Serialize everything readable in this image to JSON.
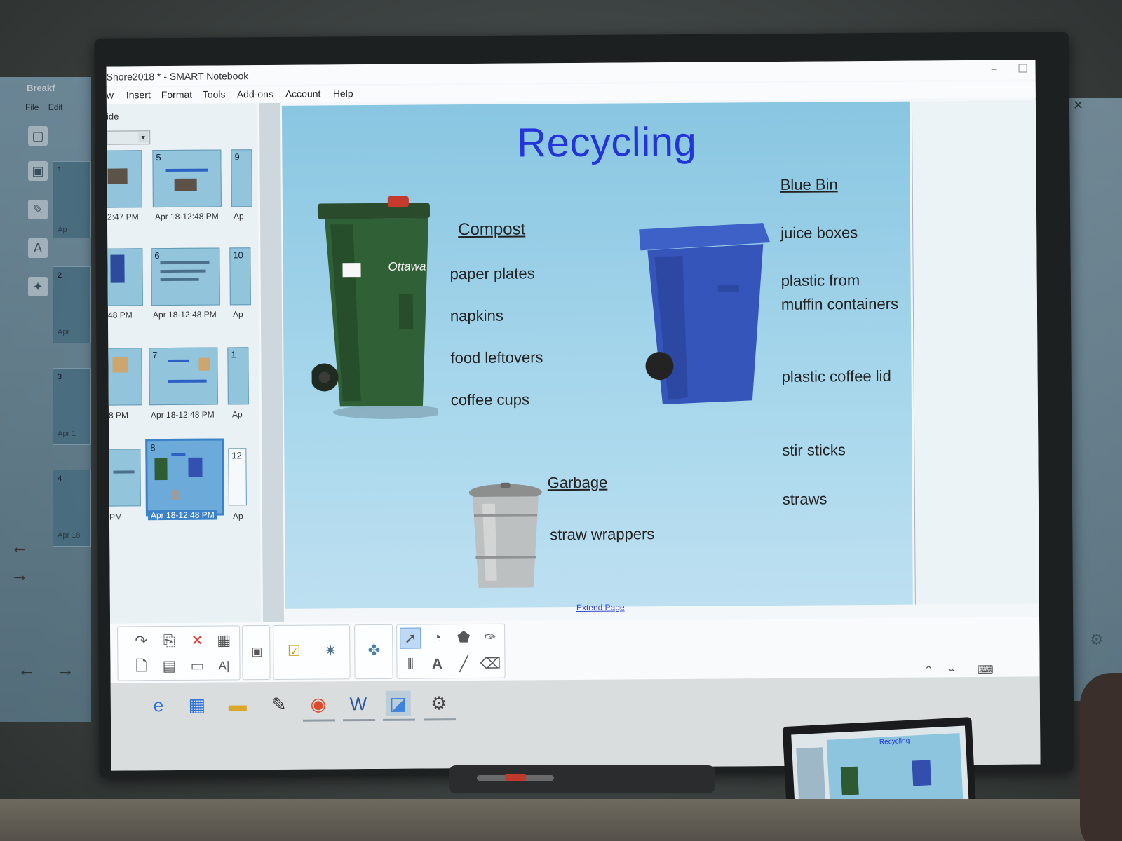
{
  "window": {
    "title": "Shore2018 * - SMART Notebook",
    "minimize": "–"
  },
  "menu": {
    "items": [
      "w",
      "Insert",
      "Format",
      "Tools",
      "Add-ons",
      "Account",
      "Help"
    ]
  },
  "ghost_window": {
    "title": "Breakf",
    "menu": [
      "File",
      "Edit"
    ],
    "thumb_numbers": [
      "1",
      "2",
      "3",
      "4"
    ],
    "dates": [
      "Ap",
      "Apr",
      "Apr 1",
      "Apr 18"
    ]
  },
  "sorter": {
    "hide_label": "ide",
    "scroll_arrow": "›",
    "columns": [
      {
        "numbers": [
          "",
          "",
          "",
          ""
        ],
        "labels": [
          "2:47 PM",
          "48 PM",
          "8 PM",
          "PM"
        ]
      },
      {
        "numbers": [
          "5",
          "6",
          "7",
          "8"
        ],
        "labels": [
          "Apr 18-12:48 PM",
          "Apr 18-12:48 PM",
          "Apr 18-12:48 PM",
          "Apr 18-12:48 PM"
        ]
      },
      {
        "numbers": [
          "9",
          "10",
          "1",
          "12"
        ],
        "labels": [
          "Ap",
          "Ap",
          "Ap",
          "Ap"
        ]
      }
    ]
  },
  "slide": {
    "title": "Recycling",
    "compost": {
      "heading": "Compost",
      "items": [
        "paper plates",
        "napkins",
        "food leftovers",
        "coffee cups"
      ]
    },
    "blue_bin": {
      "heading": "Blue Bin",
      "items": [
        "juice boxes",
        "plastic from muffin containers",
        "plastic coffee lid",
        "stir sticks",
        "straws"
      ]
    },
    "garbage": {
      "heading": "Garbage",
      "items": [
        "straw wrappers"
      ]
    },
    "bin_logo": "Ottawa",
    "extend_link": "Extend Page"
  },
  "toolbar": {
    "icons": [
      "redo-icon",
      "paste-icon",
      "delete-icon",
      "table-icon",
      "open-icon",
      "save-icon",
      "screen-shade-icon",
      "spell-check-icon",
      "screen-capture-icon",
      "response-icon",
      "addon-icon",
      "puzzle-icon",
      "select-icon",
      "shapes-icon",
      "fill-icon",
      "pen-icon",
      "magic-pen-icon",
      "text-icon",
      "line-icon",
      "eraser-icon"
    ]
  },
  "taskbar": {
    "apps": [
      "edge-icon",
      "store-icon",
      "explorer-icon",
      "smart-ink-icon",
      "chrome-icon",
      "word-icon",
      "notebook-icon",
      "settings-icon"
    ]
  },
  "laptop": {
    "slide_title": "Recycling"
  },
  "colors": {
    "slide_title": "#2233d6",
    "slide_bg": "#a3d2e6",
    "compost_bin": "#2d5a32",
    "blue_bin": "#334fae"
  }
}
